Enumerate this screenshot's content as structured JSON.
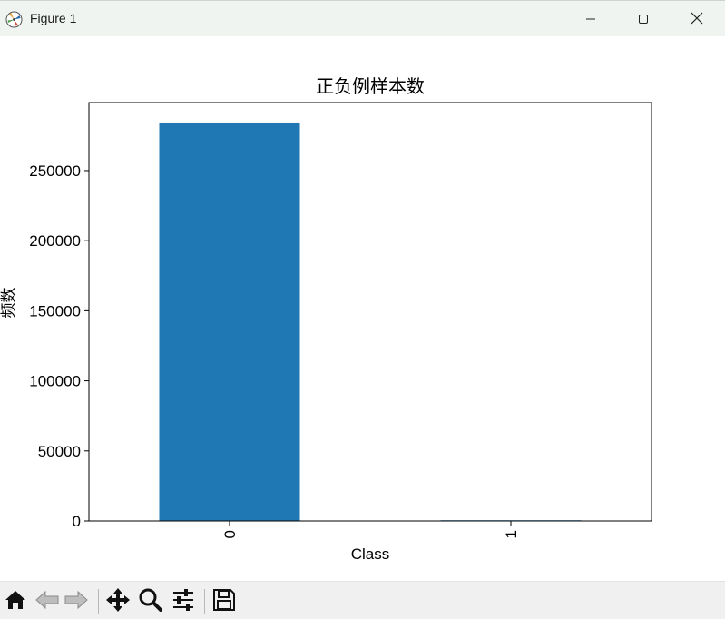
{
  "window": {
    "title": "Figure 1",
    "icons": {
      "app": "matplotlib-logo-icon",
      "minimize": "minimize-icon",
      "maximize": "maximize-icon",
      "close": "close-icon"
    }
  },
  "toolbar": {
    "buttons": [
      {
        "name": "home-icon",
        "tooltip": "Reset original view"
      },
      {
        "name": "back-arrow-icon",
        "tooltip": "Back"
      },
      {
        "name": "forward-arrow-icon",
        "tooltip": "Forward"
      },
      {
        "name": "pan-move-icon",
        "tooltip": "Pan"
      },
      {
        "name": "zoom-magnifier-icon",
        "tooltip": "Zoom"
      },
      {
        "name": "configure-sliders-icon",
        "tooltip": "Configure subplots"
      },
      {
        "name": "save-floppy-icon",
        "tooltip": "Save"
      }
    ]
  },
  "chart_data": {
    "type": "bar",
    "title": "正负例样本数",
    "xlabel": "Class",
    "ylabel": "频数",
    "categories": [
      "0",
      "1"
    ],
    "values": [
      284315,
      492
    ],
    "ylim": [
      0,
      298540
    ],
    "yticks": [
      0,
      50000,
      100000,
      150000,
      200000,
      250000
    ],
    "bar_color": "#1f77b4",
    "grid": false,
    "legend": "none",
    "xtick_rotation": "vertical"
  }
}
